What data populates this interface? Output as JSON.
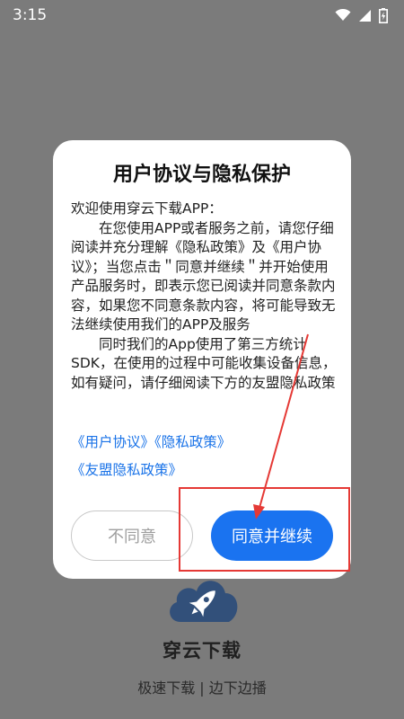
{
  "status_bar": {
    "time": "3:15",
    "icons": [
      "wifi-icon",
      "signal-icon",
      "battery-charging-icon"
    ]
  },
  "background_app": {
    "logo_icon": "rocket-cloud-icon",
    "name": "穿云下载",
    "slogan": "极速下载 | 边下边播"
  },
  "dialog": {
    "title": "用户协议与隐私保护",
    "paragraphs": [
      "欢迎使用穿云下载APP：",
      "在您使用APP或者服务之前，请您仔细阅读并充分理解《隐私政策》及《用户协议》；当您点击＂同意并继续＂并开始使用产品服务时，即表示您已阅读并同意条款内容，如果您不同意条款内容，将可能导致无法继续使用我们的APP及服务",
      "同时我们的App使用了第三方统计SDK，在使用的过程中可能收集设备信息，如有疑问，请仔细阅读下方的友盟隐私政策"
    ],
    "links": {
      "user_agreement": "《用户协议》",
      "privacy_policy": "《隐私政策》",
      "umeng_privacy": "《友盟隐私政策》"
    },
    "buttons": {
      "disagree": "不同意",
      "agree": "同意并继续"
    }
  },
  "colors": {
    "overlay": "#7b7b7b",
    "link": "#1a73e8",
    "primary": "#1a73f0",
    "annotation": "#e53935"
  }
}
